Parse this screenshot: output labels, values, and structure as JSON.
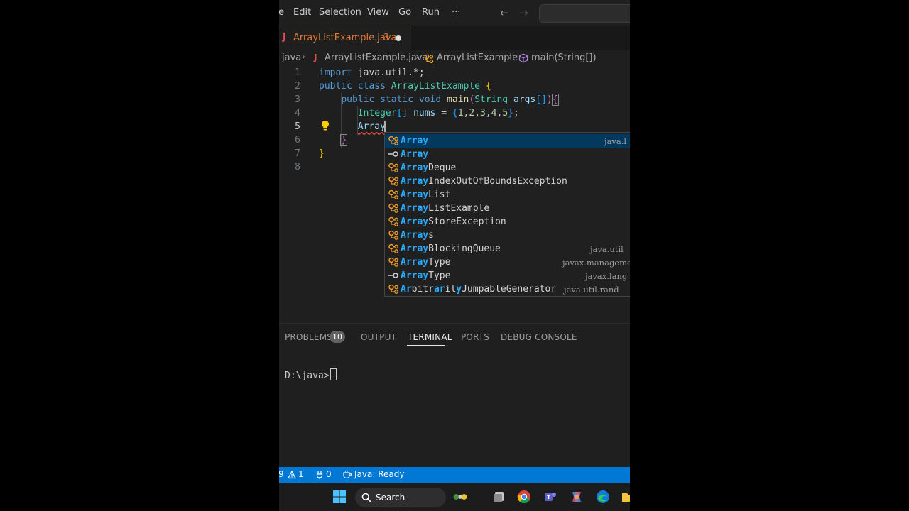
{
  "menu": {
    "items": [
      "e",
      "Edit",
      "Selection",
      "View",
      "Go",
      "Run",
      "···"
    ]
  },
  "tab": {
    "icon": "J",
    "filename": "ArrayListExample.java",
    "problems": "3"
  },
  "breadcrumb": {
    "folder": "java",
    "file_icon": "J",
    "file": "ArrayListExample.java",
    "class": "ArrayListExample",
    "method": "main(String[])"
  },
  "editor": {
    "line_numbers": [
      "1",
      "2",
      "3",
      "4",
      "5",
      "6",
      "7",
      "8"
    ],
    "current_line": 5,
    "typed_text": "Array"
  },
  "suggestions": [
    {
      "icon": "class-icon",
      "match": "Array",
      "rest": "",
      "detail": "java.l"
    },
    {
      "icon": "interface-icon",
      "match": "Array",
      "rest": "",
      "detail": ""
    },
    {
      "icon": "class-icon",
      "match": "Array",
      "rest": "Deque",
      "detail": ""
    },
    {
      "icon": "class-icon",
      "match": "Array",
      "rest": "IndexOutOfBoundsException",
      "detail": ""
    },
    {
      "icon": "class-icon",
      "match": "Array",
      "rest": "List",
      "detail": ""
    },
    {
      "icon": "class-icon",
      "match": "Array",
      "rest": "ListExample",
      "detail": ""
    },
    {
      "icon": "class-icon",
      "match": "Array",
      "rest": "StoreException",
      "detail": ""
    },
    {
      "icon": "class-icon",
      "match": "Array",
      "rest": "s",
      "detail": ""
    },
    {
      "icon": "class-icon",
      "match": "Array",
      "rest": "BlockingQueue",
      "detail": "java.util"
    },
    {
      "icon": "class-icon",
      "match": "Array",
      "rest": "Type",
      "detail": "javax.managemer"
    },
    {
      "icon": "interface-icon",
      "match": "Array",
      "rest": "Type",
      "detail": "javax.lang"
    },
    {
      "icon": "class-icon",
      "match": "",
      "rest": "ArbitrarilyJumpableGenerator",
      "detail": "java.util.rand"
    }
  ],
  "panel": {
    "tabs": [
      "PROBLEMS",
      "OUTPUT",
      "TERMINAL",
      "PORTS",
      "DEBUG CONSOLE"
    ],
    "active_tab": "TERMINAL",
    "problems_count": "10",
    "terminal_prompt": "D:\\java>"
  },
  "status": {
    "errors": "9",
    "warnings": "1",
    "ports": "0",
    "java_status": "Java: Ready"
  },
  "taskbar": {
    "search_label": "Search"
  },
  "colors": {
    "accent": "#0078d4",
    "editor_bg": "#1f1f1f",
    "keyword": "#569cd6",
    "type": "#4ec9b0",
    "highlight": "#2aaaff"
  }
}
